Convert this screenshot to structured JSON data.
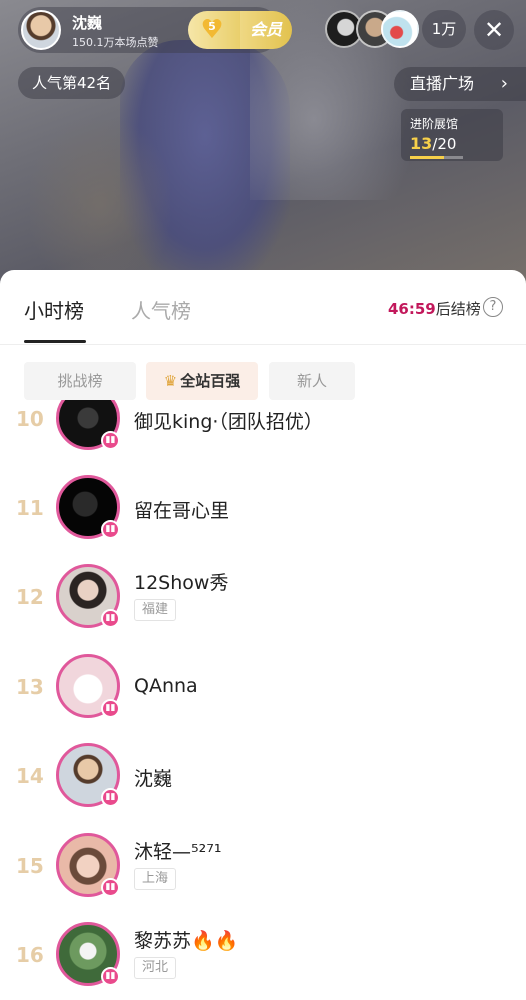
{
  "host": {
    "name": "沈巍",
    "likes": "150.1万本场点赞",
    "fan_level": "5",
    "vip_label": "会员"
  },
  "header": {
    "viewer_count": "1万",
    "popularity_rank": "人气第42名",
    "plaza_label": "直播广场",
    "gallery_title": "进阶展馆",
    "gallery_current": "13",
    "gallery_total": "/20",
    "gallery_progress": 0.65
  },
  "sheet": {
    "tabs": [
      {
        "label": "小时榜",
        "active": true
      },
      {
        "label": "人气榜",
        "active": false
      }
    ],
    "countdown_time": "46:59",
    "countdown_suffix": "后结榜",
    "subtabs": [
      {
        "label": "挑战榜",
        "active": false
      },
      {
        "label": "全站百强",
        "active": true
      },
      {
        "label": "新人",
        "active": false
      }
    ]
  },
  "ranking": [
    {
      "rank": "10",
      "name": "御见king·（团队招优）",
      "location": ""
    },
    {
      "rank": "11",
      "name": "留在哥心里",
      "location": ""
    },
    {
      "rank": "12",
      "name": "12Show秀",
      "location": "福建"
    },
    {
      "rank": "13",
      "name": "QAnna",
      "location": ""
    },
    {
      "rank": "14",
      "name": "沈巍",
      "location": ""
    },
    {
      "rank": "15",
      "name": "沐轻—⁵²⁷¹",
      "location": "上海"
    },
    {
      "rank": "16",
      "name": "黎苏苏🔥🔥",
      "location": "河北"
    }
  ],
  "colors": {
    "accent": "#c2185b",
    "live_ring": "#e0589b",
    "rank_text": "#e6cda7",
    "gallery_progress": "#f7d04a"
  },
  "icons": {
    "close": "close-icon",
    "help": "question-icon",
    "chevron": "chevron-right-icon",
    "crown": "crown-icon",
    "live": "live-bars-icon"
  }
}
